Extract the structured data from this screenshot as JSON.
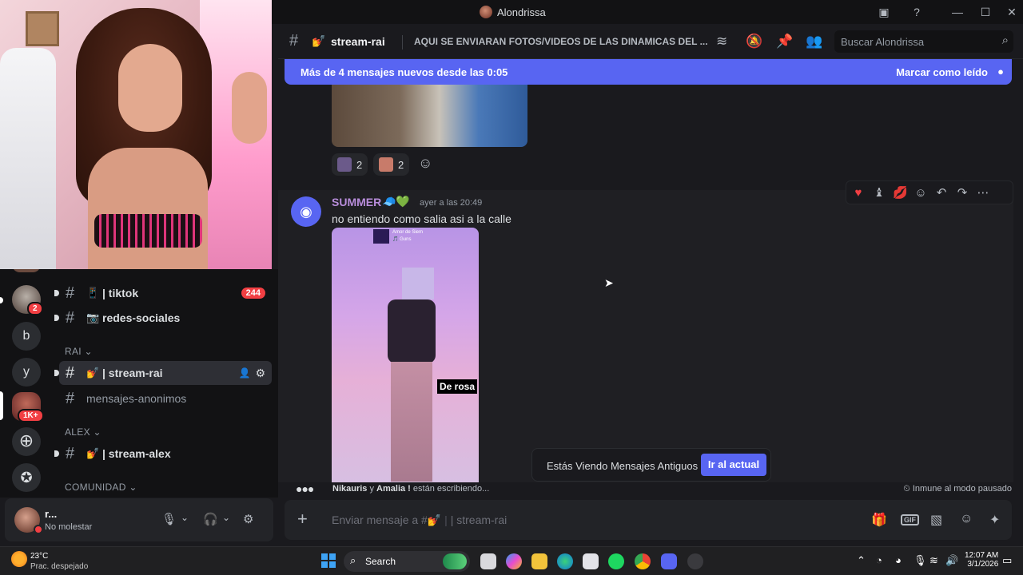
{
  "window": {
    "title": "Alondrissa"
  },
  "header": {
    "channel_name": "stream-rai",
    "channel_emoji": "💅",
    "topic": "AQUI SE ENVIARAN FOTOS/VIDEOS DE LAS DINAMICAS DEL ...",
    "search_placeholder": "Buscar Alondrissa"
  },
  "new_messages_bar": {
    "text": "Más de 4 mensajes nuevos desde las 0:05",
    "action": "Marcar como leído"
  },
  "server_rail": {
    "badge_server_1": "2",
    "letter_b": "b",
    "letter_y": "y",
    "badge_server_2": "1K+"
  },
  "sidebar": {
    "channels_top": [
      {
        "name": "| tiktok",
        "emoji": "📱",
        "badge": "244"
      },
      {
        "name": "redes-sociales",
        "emoji": "📷"
      }
    ],
    "category_rai": "RAI",
    "channels_rai": [
      {
        "name": "| stream-rai",
        "emoji": "💅"
      },
      {
        "name": "mensajes-anonimos"
      }
    ],
    "category_alex": "ALEX",
    "channels_alex": [
      {
        "name": "| stream-alex",
        "emoji": "💅"
      }
    ],
    "category_comunidad": "COMUNIDAD"
  },
  "user_panel": {
    "name": "r...",
    "status": "No molestar"
  },
  "messages": {
    "reactions": [
      {
        "count": "2",
        "color": "#6b5a8a"
      },
      {
        "count": "2",
        "color": "#c87b6a"
      }
    ],
    "post": {
      "author": "SUMMER",
      "author_badges": "🧢💚",
      "timestamp": "ayer a las 20:49",
      "text": "no entiendo como salia asi a la calle",
      "media_label": "De rosa",
      "player_title": "Amor de Siem",
      "player_sub": "🎵 Guns"
    }
  },
  "toast": {
    "text": "Estás Viendo Mensajes Antiguos",
    "button": "Ir al actual"
  },
  "typing": {
    "user1": "Nikauris",
    "conj": "y",
    "user2": "Amalia !",
    "suffix": "están escribiendo...",
    "immune": "Inmune al modo pausado"
  },
  "composer": {
    "placeholder_prefix": "Enviar mensaje a #",
    "placeholder_emoji": "💅",
    "placeholder_channel": "| stream-rai",
    "gif": "GIF"
  },
  "taskbar": {
    "temp": "23°C",
    "condition": "Prac. despejado",
    "search": "Search",
    "time": "12:07 AM",
    "date": "3/1/2026"
  },
  "colors": {
    "accent": "#5865f2",
    "danger": "#f23f43",
    "author_color": "#b88ddb"
  }
}
